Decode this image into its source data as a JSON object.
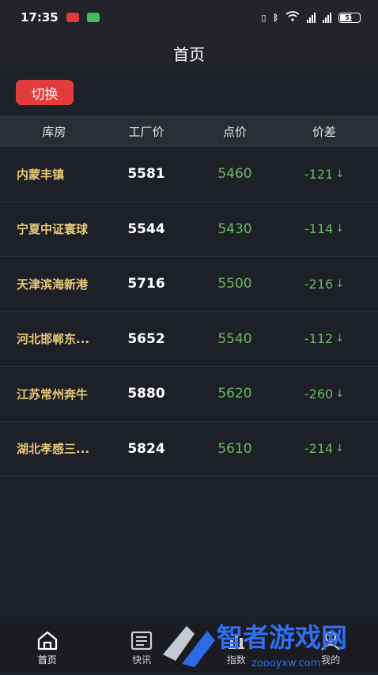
{
  "status_bar": {
    "time": "17:35",
    "battery": "51"
  },
  "header": {
    "title": "首页"
  },
  "switch_button": {
    "label": "切换"
  },
  "table": {
    "columns": [
      "库房",
      "工厂价",
      "点价",
      "价差"
    ],
    "rows": [
      {
        "warehouse": "内蒙丰镇",
        "factory_price": "5581",
        "point_price": "5460",
        "diff": "-121"
      },
      {
        "warehouse": "宁夏中证寰球",
        "factory_price": "5544",
        "point_price": "5430",
        "diff": "-114"
      },
      {
        "warehouse": "天津滨海新港",
        "factory_price": "5716",
        "point_price": "5500",
        "diff": "-216"
      },
      {
        "warehouse": "河北邯郸东...",
        "factory_price": "5652",
        "point_price": "5540",
        "diff": "-112"
      },
      {
        "warehouse": "江苏常州奔牛",
        "factory_price": "5880",
        "point_price": "5620",
        "diff": "-260"
      },
      {
        "warehouse": "湖北孝感三...",
        "factory_price": "5824",
        "point_price": "5610",
        "diff": "-214"
      }
    ]
  },
  "tabbar": {
    "items": [
      {
        "label": "首页",
        "icon": "home-icon"
      },
      {
        "label": "快讯",
        "icon": "news-icon"
      },
      {
        "label": "指数",
        "icon": "index-icon"
      },
      {
        "label": "我的",
        "icon": "user-icon"
      }
    ]
  },
  "watermark": {
    "text": "智者游戏网",
    "subtext": "zoooyxw.com"
  },
  "colors": {
    "accent_red": "#e23b3b",
    "gold": "#e6c978",
    "green": "#69b861"
  }
}
